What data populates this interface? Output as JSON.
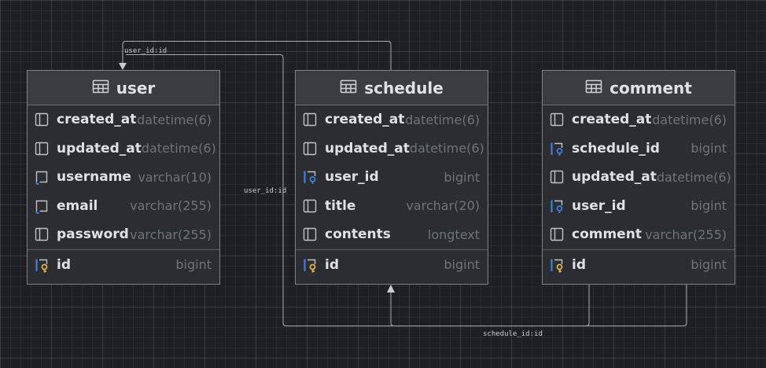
{
  "colors": {
    "background": "#1e1f22",
    "table_fill": "#2b2d30",
    "header_fill": "#3a3c40",
    "connector": "#a9acb2",
    "fk_icon": "#3d7fe0",
    "pk_key": "#e0b441"
  },
  "icons": {
    "table": "table-grid-icon",
    "column": "column-icon",
    "not_null_column": "column-notnull-icon",
    "foreign_key": "foreign-key-icon",
    "primary_key": "primary-key-icon"
  },
  "edge_labels": {
    "top": "user_id:id",
    "middle": "user_id:id",
    "bottom": "schedule_id:id"
  },
  "tables": [
    {
      "name": "user",
      "columns": [
        {
          "name": "created_at",
          "type": "datetime(6)",
          "icon": "column"
        },
        {
          "name": "updated_at",
          "type": "datetime(6)",
          "icon": "column"
        },
        {
          "name": "username",
          "type": "varchar(10)",
          "icon": "not_null_column"
        },
        {
          "name": "email",
          "type": "varchar(255)",
          "icon": "not_null_column"
        },
        {
          "name": "password",
          "type": "varchar(255)",
          "icon": "column"
        }
      ],
      "pk": {
        "name": "id",
        "type": "bigint",
        "icon": "primary_key"
      }
    },
    {
      "name": "schedule",
      "columns": [
        {
          "name": "created_at",
          "type": "datetime(6)",
          "icon": "column"
        },
        {
          "name": "updated_at",
          "type": "datetime(6)",
          "icon": "column"
        },
        {
          "name": "user_id",
          "type": "bigint",
          "icon": "foreign_key"
        },
        {
          "name": "title",
          "type": "varchar(20)",
          "icon": "column"
        },
        {
          "name": "contents",
          "type": "longtext",
          "icon": "column"
        }
      ],
      "pk": {
        "name": "id",
        "type": "bigint",
        "icon": "primary_key"
      }
    },
    {
      "name": "comment",
      "columns": [
        {
          "name": "created_at",
          "type": "datetime(6)",
          "icon": "column"
        },
        {
          "name": "schedule_id",
          "type": "bigint",
          "icon": "foreign_key"
        },
        {
          "name": "updated_at",
          "type": "datetime(6)",
          "icon": "column"
        },
        {
          "name": "user_id",
          "type": "bigint",
          "icon": "foreign_key"
        },
        {
          "name": "comment",
          "type": "varchar(255)",
          "icon": "column"
        }
      ],
      "pk": {
        "name": "id",
        "type": "bigint",
        "icon": "primary_key"
      }
    }
  ]
}
